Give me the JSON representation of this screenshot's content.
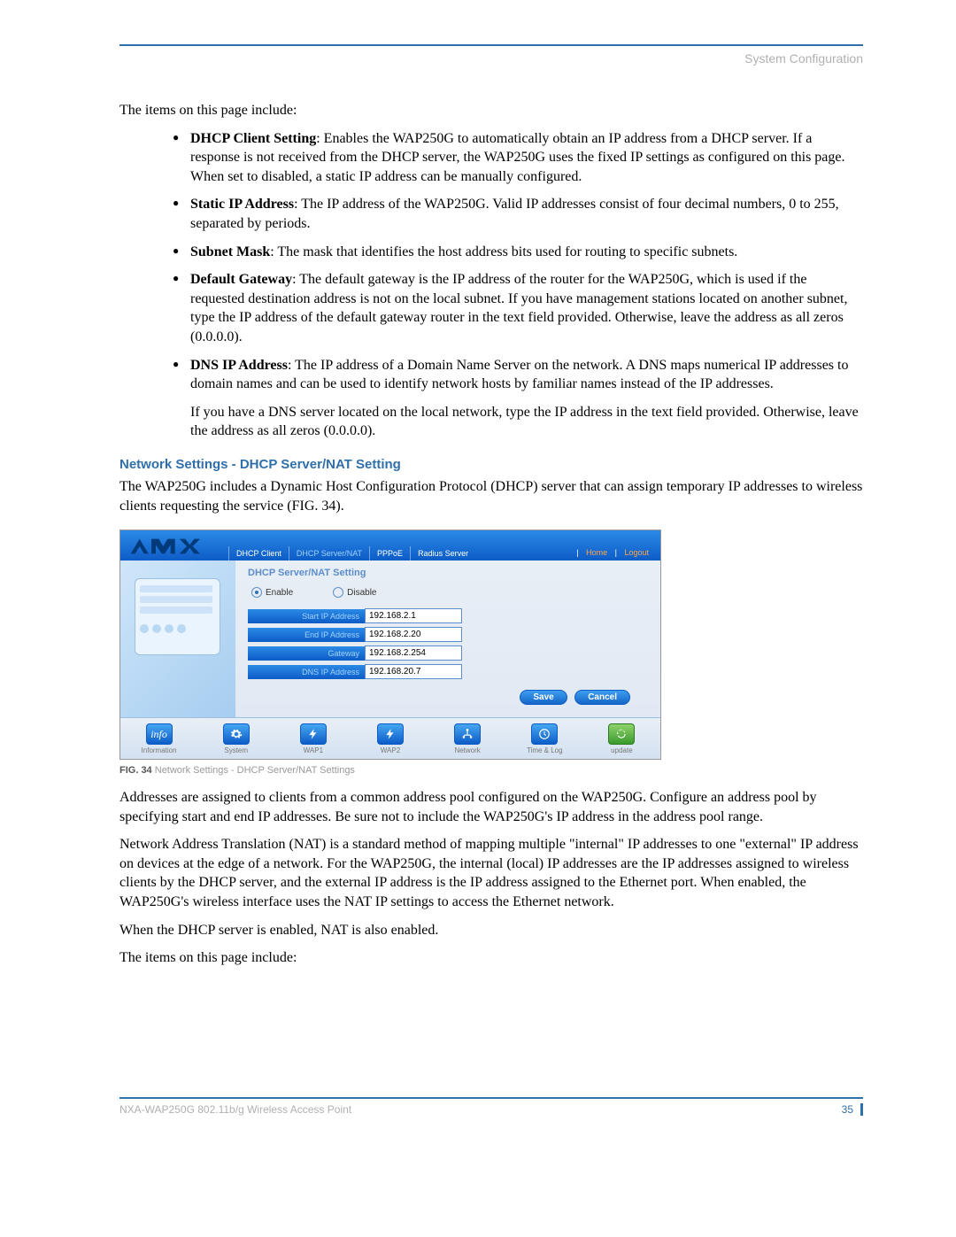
{
  "header": {
    "title": "System Configuration"
  },
  "intro": "The items on this page include:",
  "bullets": [
    {
      "label": "DHCP Client Setting",
      "text": ": Enables the WAP250G to automatically obtain an IP address from a DHCP server. If a response is not received from the DHCP server, the WAP250G uses the fixed IP settings as configured on this page. When set to disabled, a static IP address can be manually configured."
    },
    {
      "label": "Static IP Address",
      "text": ": The IP address of the WAP250G. Valid IP addresses consist of four decimal numbers, 0 to 255, separated by periods."
    },
    {
      "label": "Subnet Mask",
      "text": ": The mask that identifies the host address bits used for routing to specific subnets."
    },
    {
      "label": "Default Gateway",
      "text": ": The default gateway is the IP address of the router for the WAP250G, which is used if the requested destination address is not on the local subnet. If you have management stations located on another subnet, type the IP address of the default gateway router in the text field provided. Otherwise, leave the address as all zeros (0.0.0.0)."
    },
    {
      "label": "DNS IP Address",
      "text": ": The IP address of a Domain Name Server on the network. A DNS maps numerical IP addresses to domain names and can be used to identify network hosts by familiar names instead of the IP addresses."
    }
  ],
  "extra_para": "If you have a DNS server located on the local network, type the IP address in the text field provided. Otherwise, leave the address as all zeros (0.0.0.0).",
  "section": {
    "heading": "Network Settings - DHCP Server/NAT Setting",
    "body1": "The WAP250G includes a Dynamic Host Configuration Protocol (DHCP) server that can assign temporary IP addresses to wireless clients requesting the service (FIG. 34)."
  },
  "figure": {
    "tabs": [
      "DHCP Client",
      "DHCP Server/NAT",
      "PPPoE",
      "Radius Server"
    ],
    "active_tab_index": 1,
    "top_links": {
      "home": "Home",
      "logout": "Logout"
    },
    "panel_title": "DHCP Server/NAT Setting",
    "radio": {
      "enable": "Enable",
      "disable": "Disable",
      "selected": "enable"
    },
    "fields": [
      {
        "label": "Start IP Address",
        "value": "192.168.2.1"
      },
      {
        "label": "End IP Address",
        "value": "192.168.2.20"
      },
      {
        "label": "Gateway",
        "value": "192.168.2.254"
      },
      {
        "label": "DNS IP Address",
        "value": "192.168.20.7"
      }
    ],
    "buttons": {
      "save": "Save",
      "cancel": "Cancel"
    },
    "nav": [
      {
        "name": "Information",
        "icon": "info"
      },
      {
        "name": "System",
        "icon": "gear"
      },
      {
        "name": "WAP1",
        "icon": "bolt"
      },
      {
        "name": "WAP2",
        "icon": "bolt"
      },
      {
        "name": "Network",
        "icon": "network"
      },
      {
        "name": "Time & Log",
        "icon": "clock"
      },
      {
        "name": "update",
        "icon": "refresh"
      }
    ]
  },
  "caption": {
    "prefix": "FIG. 34",
    "text": "  Network Settings - DHCP Server/NAT Settings"
  },
  "body2": "Addresses are assigned to clients from a common address pool configured on the WAP250G. Configure an address pool by specifying start and end IP addresses. Be sure not to include the WAP250G's IP address in the address pool range.",
  "body3": "Network Address Translation (NAT) is a standard method of mapping multiple \"internal\" IP addresses to one \"external\" IP address on devices at the edge of a network. For the WAP250G, the internal (local) IP addresses are the IP addresses assigned to wireless clients by the DHCP server, and the external IP address is the IP address assigned to the Ethernet port. When enabled, the WAP250G's wireless interface uses the NAT IP settings to access the Ethernet network.",
  "body4": "When the DHCP server is enabled, NAT is also enabled.",
  "body5": "The items on this page include:",
  "footer": {
    "left": "NXA-WAP250G 802.11b/g Wireless Access Point",
    "page": "35"
  }
}
